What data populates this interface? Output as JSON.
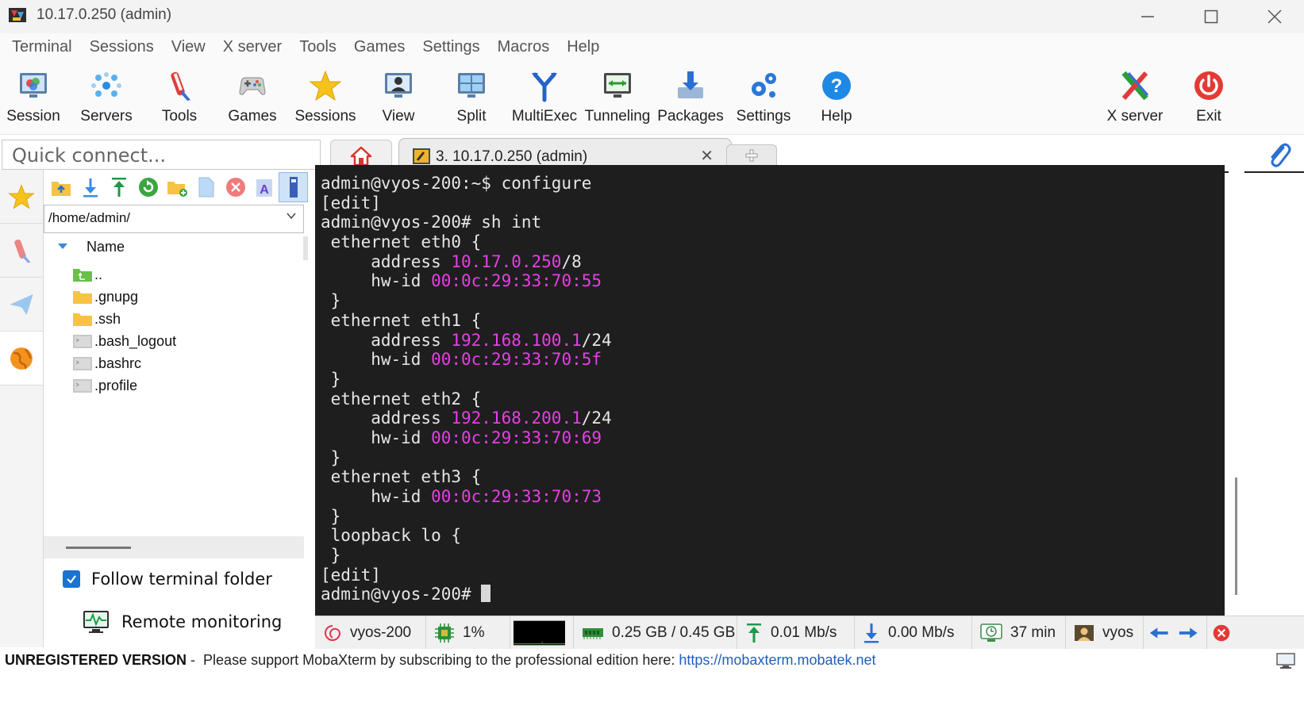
{
  "window": {
    "title": "10.17.0.250 (admin)"
  },
  "menu": [
    "Terminal",
    "Sessions",
    "View",
    "X server",
    "Tools",
    "Games",
    "Settings",
    "Macros",
    "Help"
  ],
  "toolbar": {
    "session": "Session",
    "servers": "Servers",
    "tools": "Tools",
    "games": "Games",
    "sessions": "Sessions",
    "view": "View",
    "split": "Split",
    "multiexec": "MultiExec",
    "tunneling": "Tunneling",
    "packages": "Packages",
    "settings": "Settings",
    "help": "Help",
    "xserver": "X server",
    "exit": "Exit"
  },
  "quick_connect": {
    "placeholder": "Quick connect..."
  },
  "tabs": {
    "active_label": "3. 10.17.0.250 (admin)"
  },
  "file_browser": {
    "path": "/home/admin/",
    "column_name": "Name",
    "items": [
      {
        "name": "..",
        "type": "parent"
      },
      {
        "name": ".gnupg",
        "type": "folder"
      },
      {
        "name": ".ssh",
        "type": "folder"
      },
      {
        "name": ".bash_logout",
        "type": "file"
      },
      {
        "name": ".bashrc",
        "type": "file"
      },
      {
        "name": ".profile",
        "type": "file"
      }
    ],
    "follow_terminal_label": "Follow terminal folder",
    "follow_terminal_checked": true,
    "remote_monitoring_label": "Remote monitoring"
  },
  "terminal": {
    "lines": [
      [
        {
          "t": "admin@vyos-200:~$ configure"
        }
      ],
      [
        {
          "t": "[edit]"
        }
      ],
      [
        {
          "t": "admin@vyos-200# sh int"
        }
      ],
      [
        {
          "t": " ethernet eth0 {"
        }
      ],
      [
        {
          "t": "     address "
        },
        {
          "t": "10.17.0.250",
          "c": "mag"
        },
        {
          "t": "/8"
        }
      ],
      [
        {
          "t": "     hw-id "
        },
        {
          "t": "00:0c:29:33:70:55",
          "c": "mag"
        }
      ],
      [
        {
          "t": " }"
        }
      ],
      [
        {
          "t": " ethernet eth1 {"
        }
      ],
      [
        {
          "t": "     address "
        },
        {
          "t": "192.168.100.1",
          "c": "mag"
        },
        {
          "t": "/24"
        }
      ],
      [
        {
          "t": "     hw-id "
        },
        {
          "t": "00:0c:29:33:70:5f",
          "c": "mag"
        }
      ],
      [
        {
          "t": " }"
        }
      ],
      [
        {
          "t": " ethernet eth2 {"
        }
      ],
      [
        {
          "t": "     address "
        },
        {
          "t": "192.168.200.1",
          "c": "mag"
        },
        {
          "t": "/24"
        }
      ],
      [
        {
          "t": "     hw-id "
        },
        {
          "t": "00:0c:29:33:70:69",
          "c": "mag"
        }
      ],
      [
        {
          "t": " }"
        }
      ],
      [
        {
          "t": " ethernet eth3 {"
        }
      ],
      [
        {
          "t": "     hw-id "
        },
        {
          "t": "00:0c:29:33:70:73",
          "c": "mag"
        }
      ],
      [
        {
          "t": " }"
        }
      ],
      [
        {
          "t": " loopback lo {"
        }
      ],
      [
        {
          "t": " }"
        }
      ],
      [
        {
          "t": "[edit]"
        }
      ],
      [
        {
          "t": "admin@vyos-200# "
        },
        {
          "cursor": true
        }
      ]
    ],
    "colors": {
      "background": "#1e1e1e",
      "text": "#e6e6e6",
      "highlight": "#e83ee6"
    }
  },
  "status": {
    "host": "vyos-200",
    "cpu": "1%",
    "memory": "0.25 GB / 0.45 GB",
    "upload": "0.01 Mb/s",
    "download": "0.00 Mb/s",
    "uptime": "37 min",
    "user": "vyos"
  },
  "footer": {
    "unregistered": "UNREGISTERED VERSION",
    "message": " -  Please support MobaXterm by subscribing to the professional edition here: ",
    "link": "https://mobaxterm.mobatek.net"
  }
}
